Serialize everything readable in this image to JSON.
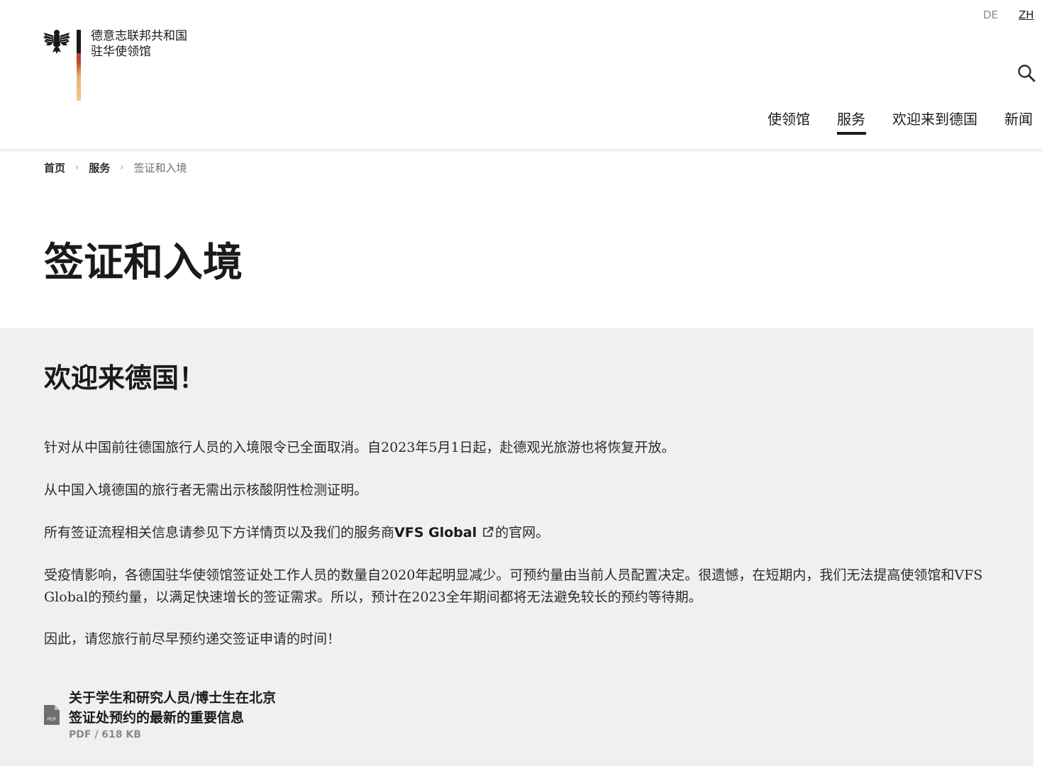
{
  "header": {
    "org_line1": "德意志联邦共和国",
    "org_line2": "驻华使领馆",
    "lang_de": "DE",
    "lang_zh": "ZH",
    "nav": {
      "embassy": "使领馆",
      "services": "服务",
      "welcome": "欢迎来到德国",
      "news": "新闻"
    },
    "active_nav": "服务"
  },
  "breadcrumb": {
    "home": "首页",
    "services": "服务",
    "current": "签证和入境",
    "separator": "›"
  },
  "page_title": "签证和入境",
  "content": {
    "heading": "欢迎来德国！",
    "p1": "针对从中国前往德国旅行人员的入境限令已全面取消。自2023年5月1日起，赴德观光旅游也将恢复开放。",
    "p2": "从中国入境德国的旅行者无需出示核酸阴性检测证明。",
    "p3_before": "所有签证流程相关信息请参见下方详情页以及我们的服务商",
    "p3_link": "VFS Global",
    "p3_after": "的官网。",
    "p4": "受疫情影响，各德国驻华使领馆签证处工作人员的数量自2020年起明显减少。可预约量由当前人员配置决定。很遗憾，在短期内，我们无法提高使领馆和VFS Global的预约量，以满足快速增长的签证需求。所以，预计在2023全年期间都将无法避免较长的预约等待期。",
    "p5": "因此，请您旅行前尽早预约递交签证申请的时间！"
  },
  "download": {
    "title_line1": "关于学生和研究人员/博士生在北京",
    "title_line2": "签证处预约的最新的重要信息",
    "meta": "PDF / 618 KB",
    "icon_label": "PDF"
  },
  "icons": {
    "logo": "federal-eagle-icon",
    "search": "search-icon",
    "external": "external-link-icon",
    "file": "pdf-file-icon"
  }
}
